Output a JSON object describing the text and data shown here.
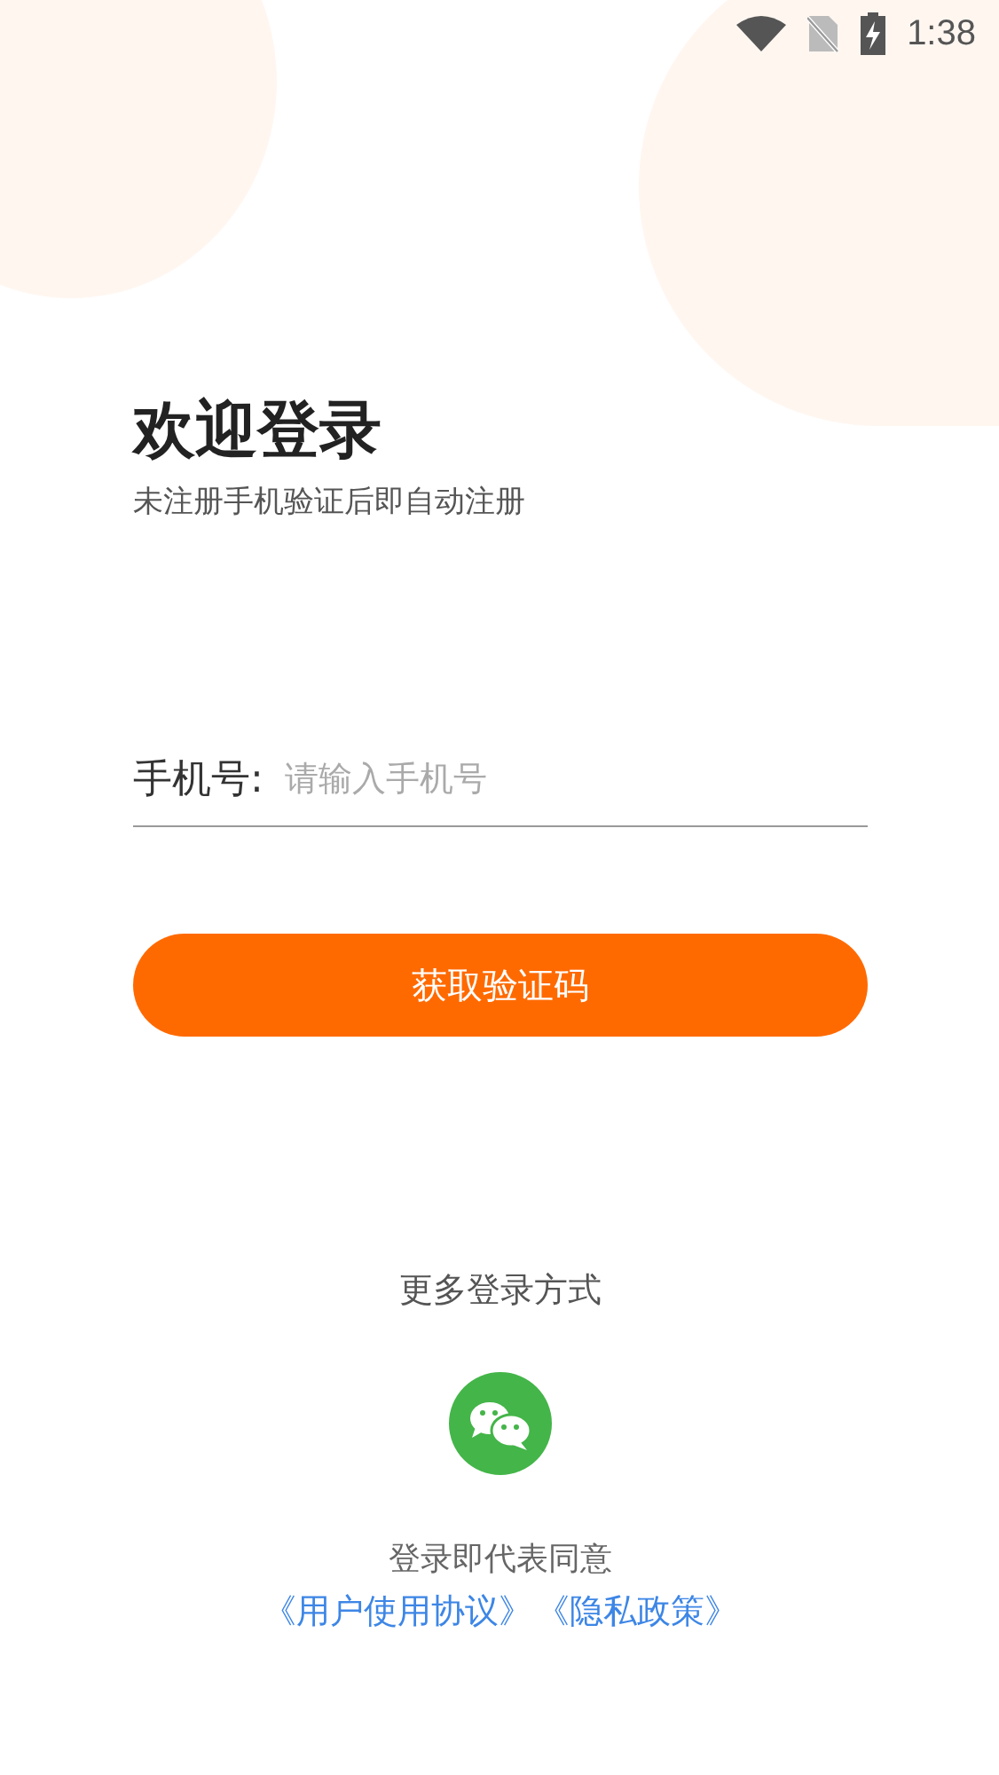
{
  "status_bar": {
    "time": "1:38"
  },
  "header": {
    "title": "欢迎登录",
    "subtitle": "未注册手机验证后即自动注册"
  },
  "phone_field": {
    "label": "手机号:",
    "placeholder": "请输入手机号"
  },
  "submit_button": {
    "label": "获取验证码"
  },
  "other_login": {
    "label": "更多登录方式"
  },
  "agreement": {
    "text": "登录即代表同意",
    "links": [
      "《用户使用协议》",
      "《隐私政策》"
    ]
  }
}
